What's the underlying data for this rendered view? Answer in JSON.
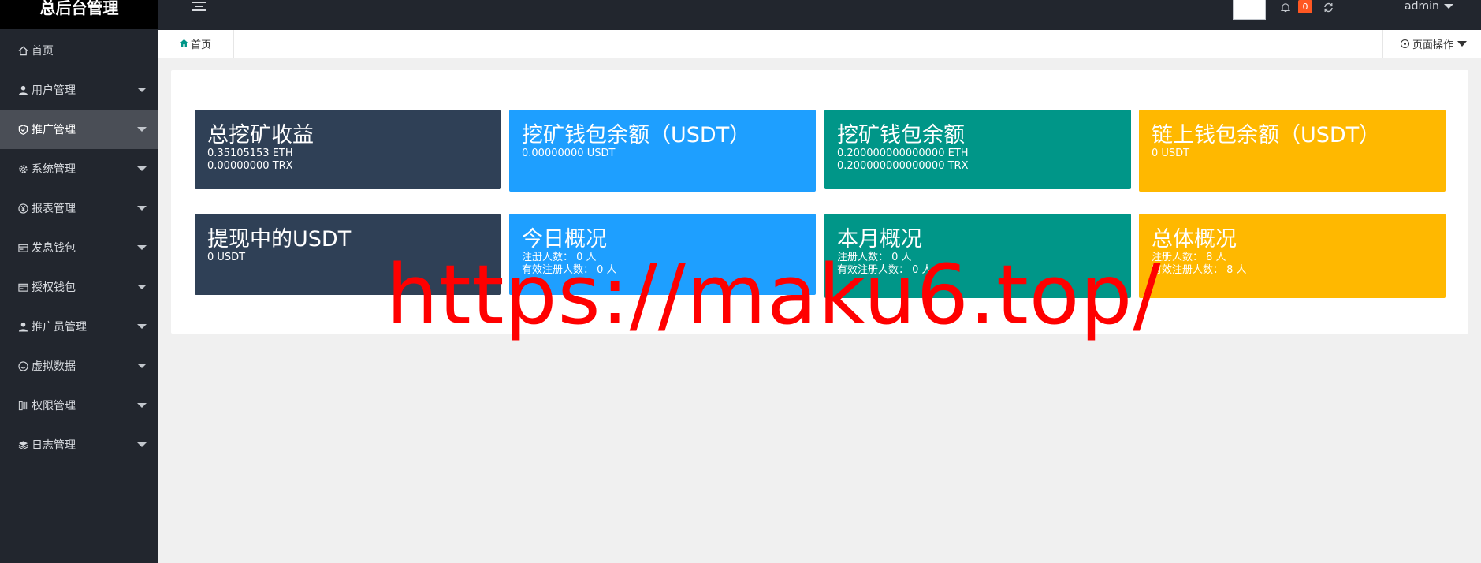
{
  "sidebar": {
    "logo": "总后台管理",
    "items": [
      {
        "label": "首页",
        "icon": "home-icon",
        "expandable": false,
        "active": false
      },
      {
        "label": "用户管理",
        "icon": "user-icon",
        "expandable": true,
        "active": false
      },
      {
        "label": "推广管理",
        "icon": "shield-icon",
        "expandable": true,
        "active": true
      },
      {
        "label": "系统管理",
        "icon": "gear-icon",
        "expandable": true,
        "active": false
      },
      {
        "label": "报表管理",
        "icon": "yen-icon",
        "expandable": true,
        "active": false
      },
      {
        "label": "发息钱包",
        "icon": "wallet-icon",
        "expandable": true,
        "active": false
      },
      {
        "label": "授权钱包",
        "icon": "wallet-icon",
        "expandable": true,
        "active": false
      },
      {
        "label": "推广员管理",
        "icon": "user-icon",
        "expandable": true,
        "active": false
      },
      {
        "label": "虚拟数据",
        "icon": "smile-icon",
        "expandable": true,
        "active": false
      },
      {
        "label": "权限管理",
        "icon": "key-icon",
        "expandable": true,
        "active": false
      },
      {
        "label": "日志管理",
        "icon": "layers-icon",
        "expandable": true,
        "active": false
      }
    ]
  },
  "topbar": {
    "notification_count": "0",
    "username": "admin"
  },
  "tabs": {
    "home_label": "首页",
    "page_ops_label": "页面操作"
  },
  "cards": [
    {
      "title": "总挖矿收益",
      "lines": [
        "0.35105153 ETH",
        "0.00000000 TRX"
      ],
      "color": "#2f4056"
    },
    {
      "title": "挖矿钱包余额（USDT）",
      "lines": [
        "0.00000000 USDT"
      ],
      "color": "#1e9fff"
    },
    {
      "title": "挖矿钱包余额",
      "lines": [
        "0.200000000000000 ETH",
        "0.200000000000000 TRX"
      ],
      "color": "#009688"
    },
    {
      "title": "链上钱包余额（USDT）",
      "lines": [
        "0 USDT"
      ],
      "color": "#ffb800"
    },
    {
      "title": "提现中的USDT",
      "lines": [
        "0 USDT"
      ],
      "color": "#2f4056"
    },
    {
      "title": "今日概况",
      "lines": [
        "注册人数：  0 人",
        "有效注册人数：  0 人"
      ],
      "color": "#1e9fff"
    },
    {
      "title": "本月概况",
      "lines": [
        "注册人数：  0 人",
        "有效注册人数：  0 人"
      ],
      "color": "#009688"
    },
    {
      "title": "总体概况",
      "lines": [
        "注册人数：  8 人",
        "有效注册人数：  8 人"
      ],
      "color": "#ffb800"
    }
  ],
  "watermark": "https://maku6.top/"
}
